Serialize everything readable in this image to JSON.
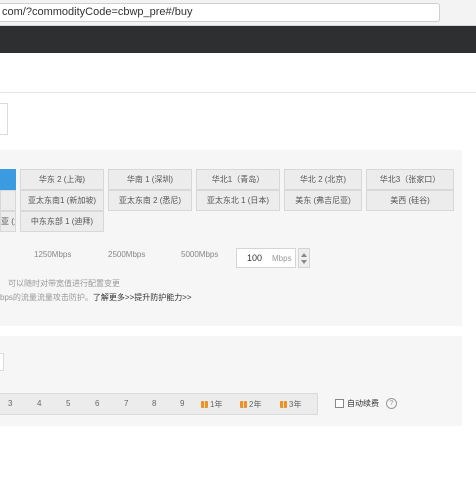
{
  "browser": {
    "url": "com/?commodityCode=cbwp_pre#/buy"
  },
  "regions": {
    "row1": [
      "华东 2 (上海)",
      "华南 1 (深圳)",
      "华北1（青岛）",
      "华北 2 (北京)",
      "华北3（张家口）"
    ],
    "row2": [
      "亚太东南1 (新加坡)",
      "亚太东南 2 (悉尼)",
      "亚太东北 1 (日本)",
      "美东 (弗吉尼亚)",
      "美西 (硅谷)"
    ],
    "row3_partial": "亚 (孟买)",
    "row3": [
      "中东东部 1 (迪拜)"
    ]
  },
  "bandwidth": {
    "ticks": [
      "1250Mbps",
      "2500Mbps",
      "5000Mbps"
    ],
    "value": "100",
    "unit": "Mbps"
  },
  "hints": {
    "line1": "可以随时对带宽值进行配置变更",
    "line2_prefix": "bps的流量流量攻击防护。",
    "line2_link": "了解更多>>提升防护能力>>"
  },
  "duration": {
    "months": [
      "3",
      "4",
      "5",
      "6",
      "7",
      "8",
      "9"
    ],
    "years": [
      "1年",
      "2年",
      "3年"
    ],
    "auto_renew_label": "自动续费",
    "help_symbol": "?"
  }
}
